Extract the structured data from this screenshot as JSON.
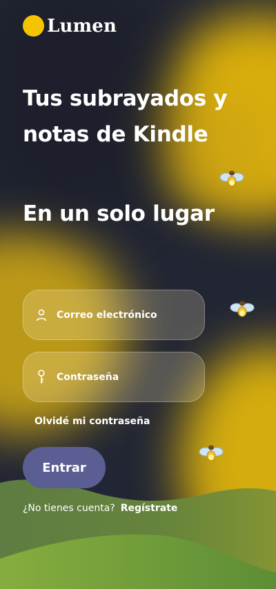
{
  "brand": {
    "name": "Lumen",
    "logo_color": "#f5c400"
  },
  "hero": {
    "headline": "Tus subrayados y notas de Kindle",
    "subheadline": "En un solo lugar"
  },
  "form": {
    "email_placeholder": "Correo electrónico",
    "email_icon": "user-icon",
    "password_placeholder": "Contraseña",
    "password_icon": "key-icon",
    "forgot_password": "Olvidé mi contraseña",
    "submit_label": "Entrar"
  },
  "signup": {
    "prompt": "¿No tienes cuenta?",
    "link": "Regístrate"
  },
  "colors": {
    "background": "#222634",
    "accent_yellow": "#d8ad0c",
    "button": "#5b5e92",
    "hill_green": "#6c8e3a"
  }
}
